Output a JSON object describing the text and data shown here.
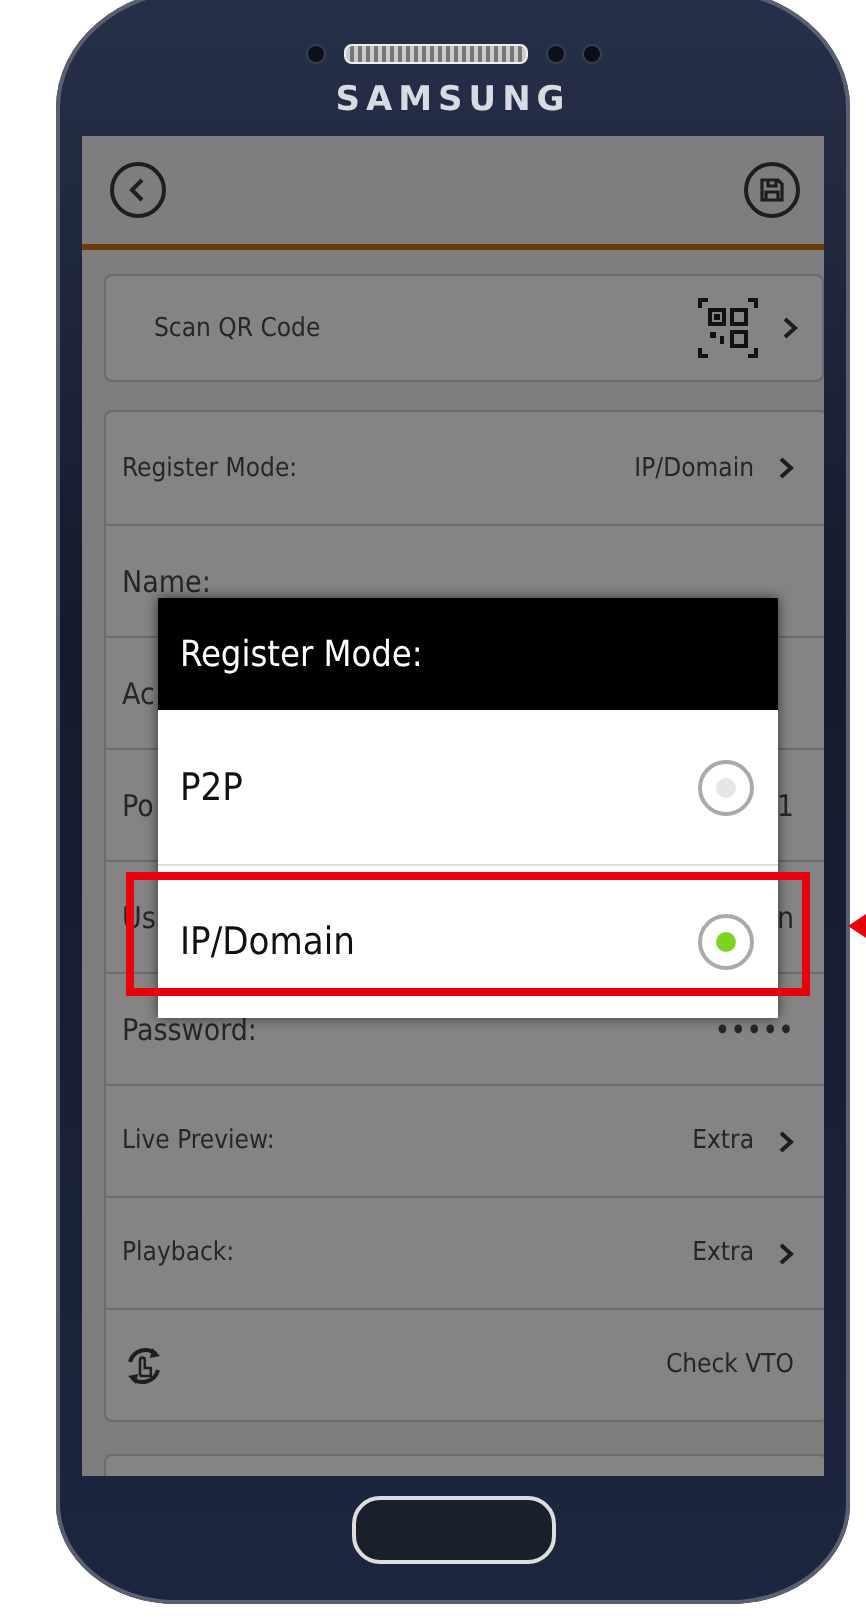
{
  "device": {
    "brand": "SAMSUNG"
  },
  "scan_qr": {
    "label": "Scan QR Code"
  },
  "rows": [
    {
      "kind": "nav",
      "label": "Register Mode:",
      "value": "IP/Domain"
    },
    {
      "kind": "text",
      "label": "Name:"
    },
    {
      "kind": "text",
      "label": "Ac"
    },
    {
      "kind": "text",
      "label": "Po",
      "value": "1"
    },
    {
      "kind": "text",
      "label": "Us",
      "value": "n"
    },
    {
      "kind": "text",
      "label": "Password:",
      "value": "•••••"
    },
    {
      "kind": "nav",
      "label": "Live Preview:",
      "value": "Extra"
    },
    {
      "kind": "nav",
      "label": "Playback:",
      "value": "Extra"
    },
    {
      "kind": "action",
      "label": "Check VTO"
    }
  ],
  "dialog": {
    "title": "Register Mode:",
    "options": [
      {
        "label": "P2P",
        "selected": false,
        "highlighted": false
      },
      {
        "label": "IP/Domain",
        "selected": true,
        "highlighted": true
      }
    ]
  }
}
